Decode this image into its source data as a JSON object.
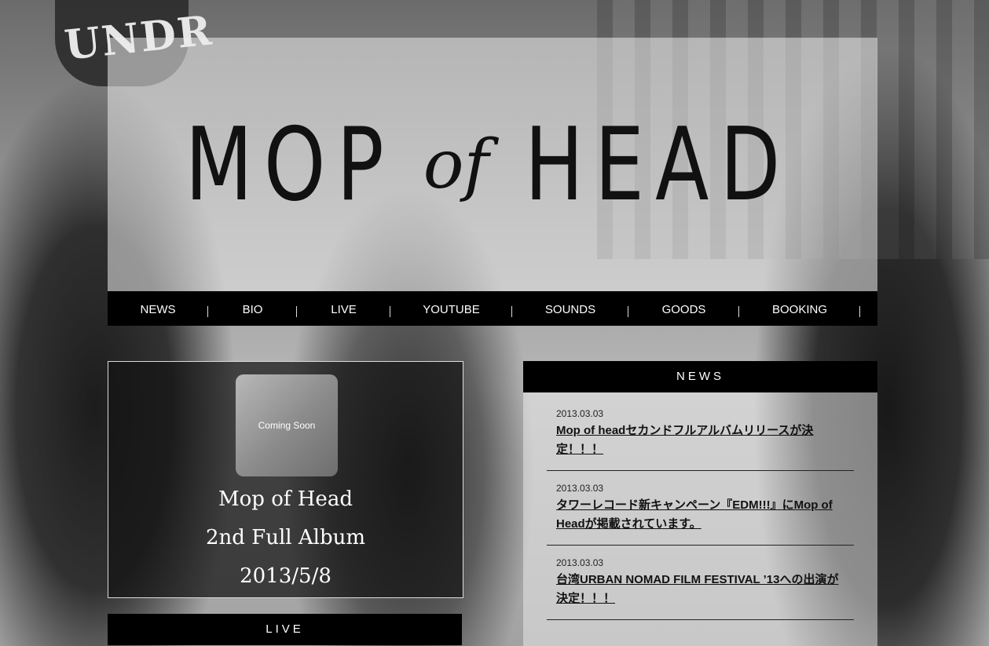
{
  "logo": {
    "word1": "MOP",
    "connector": "of",
    "word2": "HEAD"
  },
  "background": {
    "cap_text": "UNDR"
  },
  "nav": {
    "items": [
      "NEWS",
      "BIO",
      "LIVE",
      "YOUTUBE",
      "SOUNDS",
      "GOODS",
      "BOOKING"
    ]
  },
  "album": {
    "cover_text": "Coming Soon",
    "line1": "Mop of Head",
    "line2": "2nd Full Album",
    "line3": "2013/5/8"
  },
  "live": {
    "heading": "LIVE"
  },
  "news": {
    "heading": "NEWS",
    "items": [
      {
        "date": "2013.03.03",
        "title": "Mop of headセカンドフルアルバムリリースが決定！！！"
      },
      {
        "date": "2013.03.03",
        "title": "タワーレコード新キャンペーン『EDM!!!』にMop of Headが掲載されています。"
      },
      {
        "date": "2013.03.03",
        "title": "台湾URBAN NOMAD FILM FESTIVAL ’13への出演が決定！！！"
      }
    ]
  },
  "colors": {
    "nav_bg": "#000000",
    "nav_text": "#ffffff",
    "panel_overlay": "#ececec"
  }
}
